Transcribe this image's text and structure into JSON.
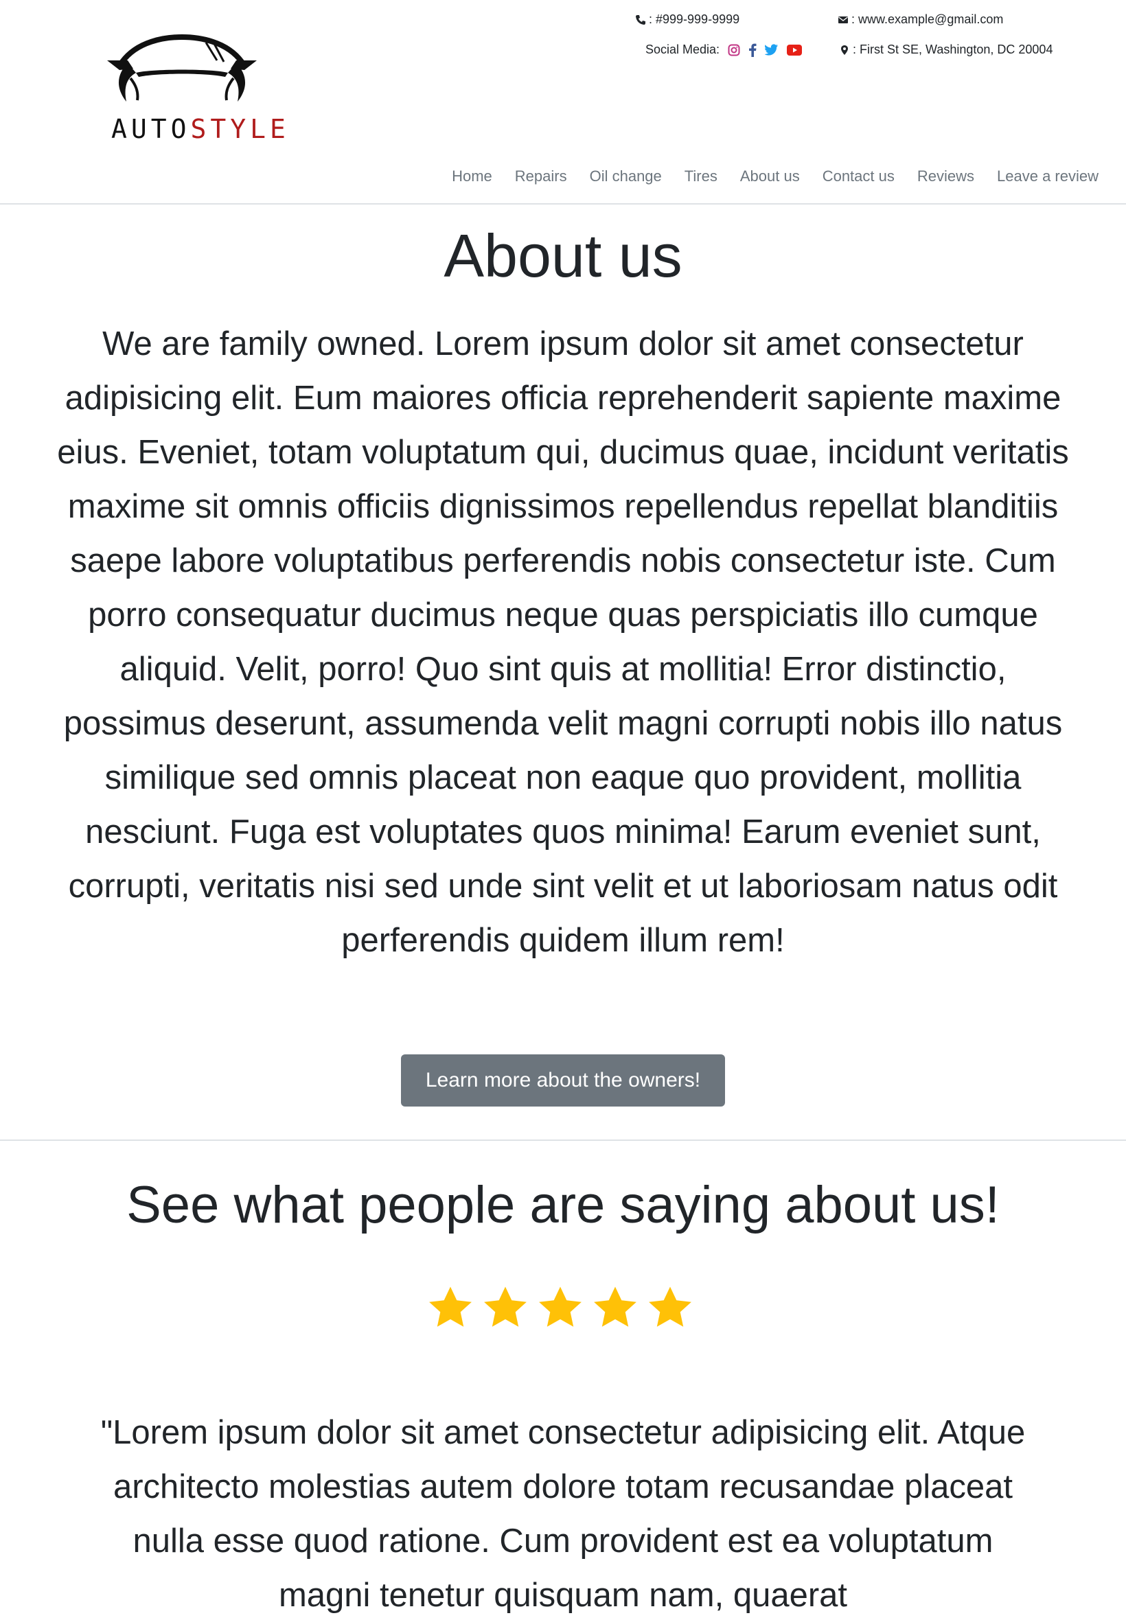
{
  "brand": {
    "logo_auto": "AUTO",
    "logo_style": "STYLE",
    "accent_color": "#b01c1c"
  },
  "contact": {
    "phone_icon": "phone-icon",
    "phone": ": #999-999-9999",
    "email_icon": "envelope-icon",
    "email": ": www.example@gmail.com",
    "social_label": "Social Media:",
    "social_icons": [
      "instagram-icon",
      "facebook-icon",
      "twitter-icon",
      "youtube-icon"
    ],
    "address_icon": "map-pin-icon",
    "address": ": First St SE, Washington, DC 20004"
  },
  "nav": {
    "items": [
      {
        "label": "Home"
      },
      {
        "label": "Repairs"
      },
      {
        "label": "Oil change"
      },
      {
        "label": "Tires"
      },
      {
        "label": "About us"
      },
      {
        "label": "Contact us"
      },
      {
        "label": "Reviews"
      },
      {
        "label": "Leave a review"
      }
    ]
  },
  "about": {
    "title": "About us",
    "text": "We are family owned. Lorem ipsum dolor sit amet consectetur adipisicing elit. Eum maiores officia reprehenderit sapiente maxime eius. Eveniet, totam voluptatum qui, ducimus quae, incidunt veritatis maxime sit omnis officiis dignissimos repellendus repellat blanditiis saepe labore voluptatibus perferendis nobis consectetur iste. Cum porro consequatur ducimus neque quas perspiciatis illo cumque aliquid. Velit, porro! Quo sint quis at mollitia! Error distinctio, possimus deserunt, assumenda velit magni corrupti nobis illo natus similique sed omnis placeat non eaque quo provident, mollitia nesciunt. Fuga est voluptates quos minima! Earum eveniet sunt, corrupti, veritatis nisi sed unde sint velit et ut laboriosam natus odit perferendis quidem illum rem!",
    "button_label": "Learn more about the owners!"
  },
  "reviews": {
    "title": "See what people are saying about us!",
    "rating": 5,
    "rating_max": 5,
    "star_color": "#ffc107",
    "quote": "\"Lorem ipsum dolor sit amet consectetur adipisicing elit. Atque architecto molestias autem dolore totam recusandae placeat nulla esse quod ratione. Cum provident est ea voluptatum magni tenetur quisquam nam, quaerat"
  }
}
